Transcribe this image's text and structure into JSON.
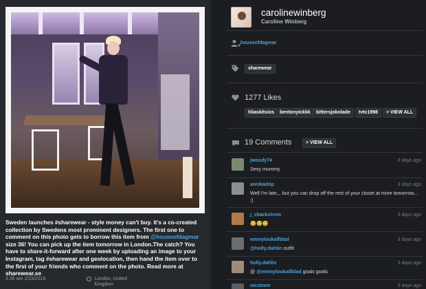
{
  "post": {
    "caption_prefix": "Sweden launches #sharewear - style money can't buy. It's a co-created collection by Swedens most prominent designers. The first one to comment on this photo gets to borrow this item from ",
    "caption_mention": "@houseofdagmar",
    "caption_suffix": " size 36! You can pick up the item tomorrow in London.The catch? You have to share-it-forward after one week by uploading an image to your Instagram, tag #sharewear and geolocation, then hand the item over to the first of your friends who comment on the photo. Read more at sharewear.se",
    "timestamp": "3.26 am 1/23/2016",
    "location": "London, United Kingdom"
  },
  "author": {
    "username": "carolinewinberg",
    "full_name": "Caroline Winberg"
  },
  "tagged_user": "houseofdagmar",
  "hashtags": [
    "sharewear"
  ],
  "likes": {
    "count_label": "1277 Likes",
    "users": [
      "hliaskitsios",
      "bentonyickkk",
      "bittersjokolade",
      "tvtc1998"
    ],
    "view_all": "> VIEW ALL"
  },
  "comments": {
    "count_label": "19 Comments",
    "view_all": "> VIEW ALL",
    "items": [
      {
        "user": "jwoody74",
        "time": "3 days ago",
        "text": "Sexy mummy",
        "avatar_color": "#7a8a70"
      },
      {
        "user": "annikadop",
        "time": "3 days ago",
        "text": "Well I'm late,,, but you can drop off the rest of your closet at mine tomorrow... ;)",
        "avatar_color": "#8a8f94"
      },
      {
        "user": "j_cbackstrom",
        "time": "3 days ago",
        "text": "😊😊😊",
        "avatar_color": "#b07a4a"
      },
      {
        "user": "emmyloukallblad",
        "time": "3 days ago",
        "mention": "@holly.dahlin",
        "text": " outfit",
        "avatar_color": "#6a6e72"
      },
      {
        "user": "holly.dahlin",
        "time": "3 days ago",
        "prefix": "@ ",
        "mention": "@emmyloukallblad",
        "text": " goals goals",
        "avatar_color": "#a08a7a"
      },
      {
        "user": "nicstrom",
        "time": "3 days ago",
        "text": "",
        "avatar_color": "#5a5e62"
      }
    ]
  },
  "colors": {
    "link": "#4da3e0",
    "background": "#1b1d20",
    "panel": "#25282c"
  }
}
